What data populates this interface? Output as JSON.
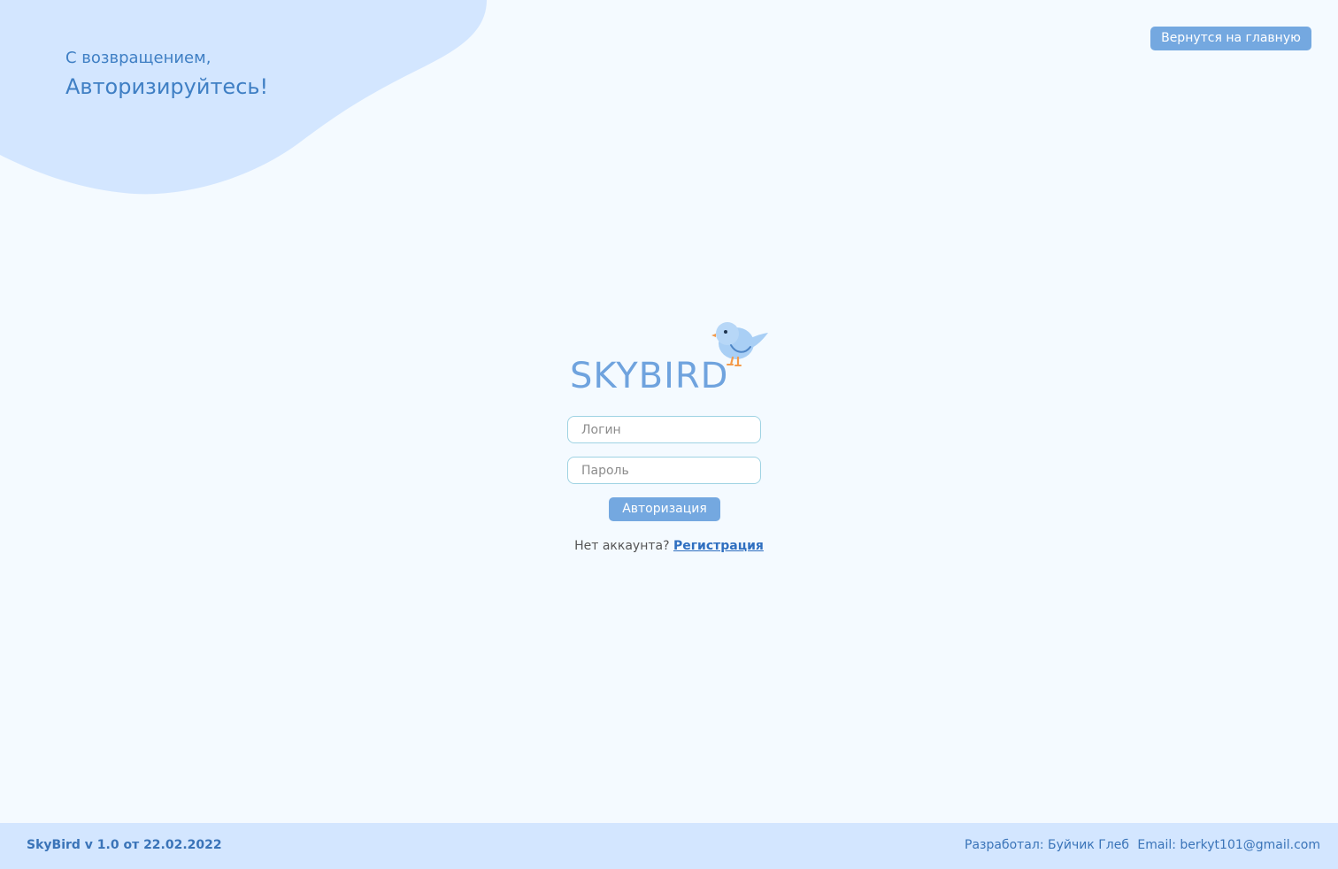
{
  "header": {
    "greeting_line1": "С возвращением,",
    "greeting_line2": "Авторизируйтесь!",
    "home_button_label": "Вернутся на главную"
  },
  "logo": {
    "text": "SKYBIRD"
  },
  "form": {
    "login_placeholder": "Логин",
    "login_value": "",
    "password_placeholder": "Пароль",
    "password_value": "",
    "submit_label": "Авторизация",
    "no_account_text": "Нет аккаунта?",
    "register_link_label": "Регистрация"
  },
  "footer": {
    "version_text": "SkyBird v 1.0 от 22.02.2022",
    "developer_text": "Разработал: Буйчик Глеб",
    "email_text": "Email: berkyt101@gmail.com"
  },
  "colors": {
    "background": "#f4faff",
    "blob": "#d3e6ff",
    "accent_button": "#74a8e0",
    "text_blue": "#3f7fc4",
    "input_border": "#9fd3e3"
  },
  "icons": {
    "logo_mascot": "bird-icon"
  }
}
